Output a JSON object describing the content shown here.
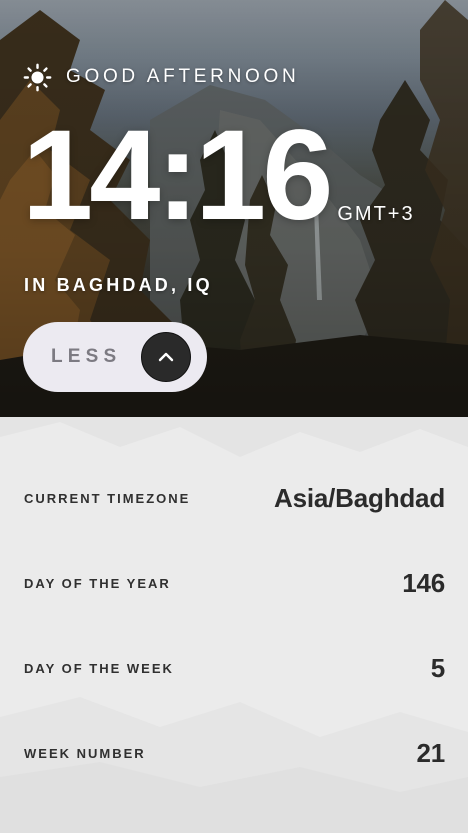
{
  "greeting": {
    "icon": "sun-icon",
    "text": "GOOD AFTERNOON"
  },
  "clock": {
    "time": "14:16",
    "abbreviation": "GMT+3"
  },
  "location": "IN BAGHDAD, IQ",
  "toggle": {
    "label": "LESS",
    "icon": "chevron-up-icon"
  },
  "details": [
    {
      "label": "CURRENT TIMEZONE",
      "value": "Asia/Baghdad"
    },
    {
      "label": "DAY OF THE YEAR",
      "value": "146"
    },
    {
      "label": "DAY OF THE WEEK",
      "value": "5"
    },
    {
      "label": "WEEK NUMBER",
      "value": "21"
    }
  ],
  "colors": {
    "panel_background": "#e9e9e9",
    "toggle_background": "#eceaf1",
    "chevron_circle": "#2a2a2a",
    "text_light": "#ffffff",
    "text_dark": "#2b2b2b"
  }
}
